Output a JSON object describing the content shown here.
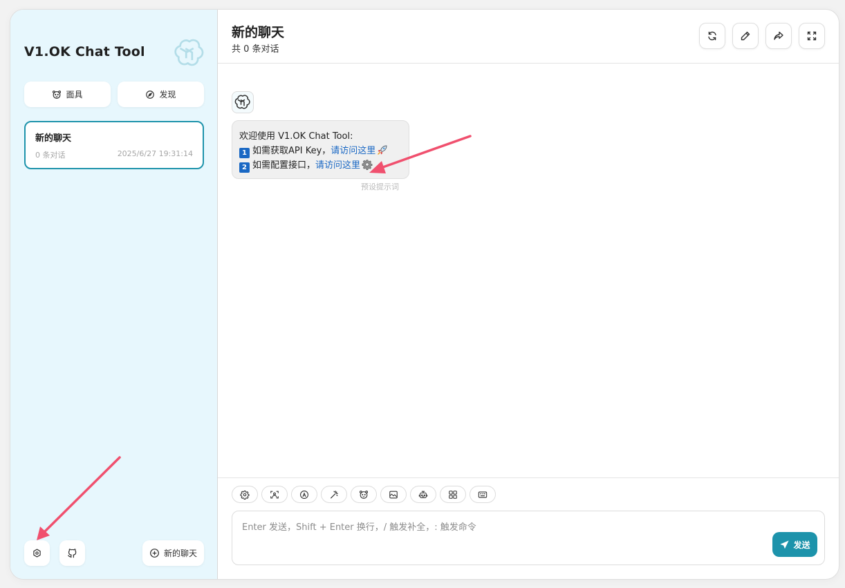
{
  "colors": {
    "accent": "#1d93ab",
    "sidebar_bg": "#e7f7fd",
    "link": "#1a68c4",
    "arrow": "#f0506e"
  },
  "sidebar": {
    "brand": "V1.OK Chat Tool",
    "logo_icon": "openai-logo-icon",
    "buttons": [
      {
        "label": "面具",
        "icon": "mask-icon"
      },
      {
        "label": "发现",
        "icon": "compass-icon"
      }
    ],
    "chats": [
      {
        "title": "新的聊天",
        "count": "0 条对话",
        "time": "2025/6/27 19:31:14"
      }
    ],
    "bottom": {
      "settings_icon": "settings-icon",
      "github_icon": "github-icon",
      "new_chat_label": "新的聊天"
    }
  },
  "header": {
    "title": "新的聊天",
    "subtitle": "共 0 条对话",
    "actions": [
      "refresh-icon",
      "edit-icon",
      "share-icon",
      "fullscreen-icon"
    ]
  },
  "messages": [
    {
      "role": "assistant",
      "intro": "欢迎使用 V1.OK Chat Tool:",
      "lines": [
        {
          "num": "1",
          "text": "如需获取API Key，",
          "link": "请访问这里",
          "emoji": "rocket-icon"
        },
        {
          "num": "2",
          "text": "如需配置接口，",
          "link": "请访问这里",
          "emoji": "gear-icon"
        }
      ],
      "tag": "预设提示词"
    }
  ],
  "input": {
    "placeholder": "Enter 发送，Shift + Enter 换行，/ 触发补全，: 触发命令",
    "send_label": "发送",
    "tools": [
      "chat-settings-icon",
      "theme-icon",
      "prompt-icon",
      "magic-wand-icon",
      "mask-icon",
      "image-icon",
      "robot-icon",
      "plugin-icon",
      "shortcut-keyboard-icon"
    ]
  }
}
